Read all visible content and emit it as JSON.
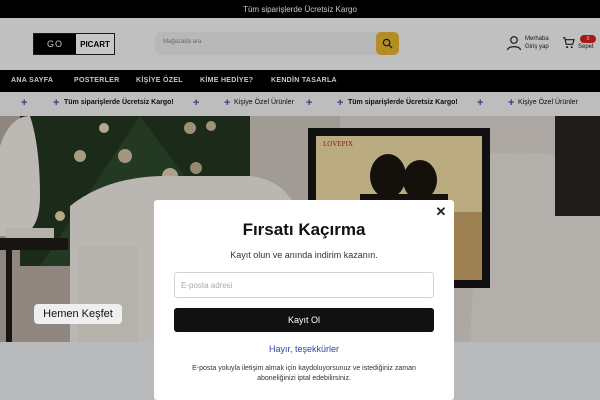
{
  "topbar": {
    "text": "Tüm siparişlerde Ücretsiz Kargo"
  },
  "logo": {
    "part1": "GO",
    "part2": "PICART"
  },
  "search": {
    "placeholder": "Mağazada ara"
  },
  "user": {
    "greeting": "Merhaba",
    "login": "Giriş yap"
  },
  "cart": {
    "count": "0",
    "label": "Sepet"
  },
  "nav": {
    "items": [
      "ANA SAYFA",
      "POSTERLER",
      "KİŞİYE ÖZEL",
      "KİME HEDİYE?",
      "KENDİN TASARLA"
    ]
  },
  "marquee": {
    "items": [
      "Tüm siparişlerde Ücretsiz Kargo!",
      "Kişiye Özel Ürünler",
      "Tüm siparişlerde Ücretsiz Kargo!",
      "Kişiye Özel Ürünler"
    ],
    "accent": "#4a4fb0"
  },
  "hero": {
    "frame_text": "LOVEPIX",
    "cta": "Hemen Keşfet"
  },
  "modal": {
    "title": "Fırsatı Kaçırma",
    "subtitle": "Kayıt olun ve anında indirim kazanın.",
    "email_placeholder": "E-posta adresi",
    "submit": "Kayıt Ol",
    "decline": "Hayır, teşekkürler",
    "note": "E-posta yoluyla iletişim almak için kaydoluyorsunuz ve istediğiniz zaman aboneliğinizi iptal edebilirsiniz."
  },
  "colors": {
    "brand_yellow": "#e7b730",
    "badge_red": "#d61f1f",
    "link_blue": "#2b47a8"
  }
}
